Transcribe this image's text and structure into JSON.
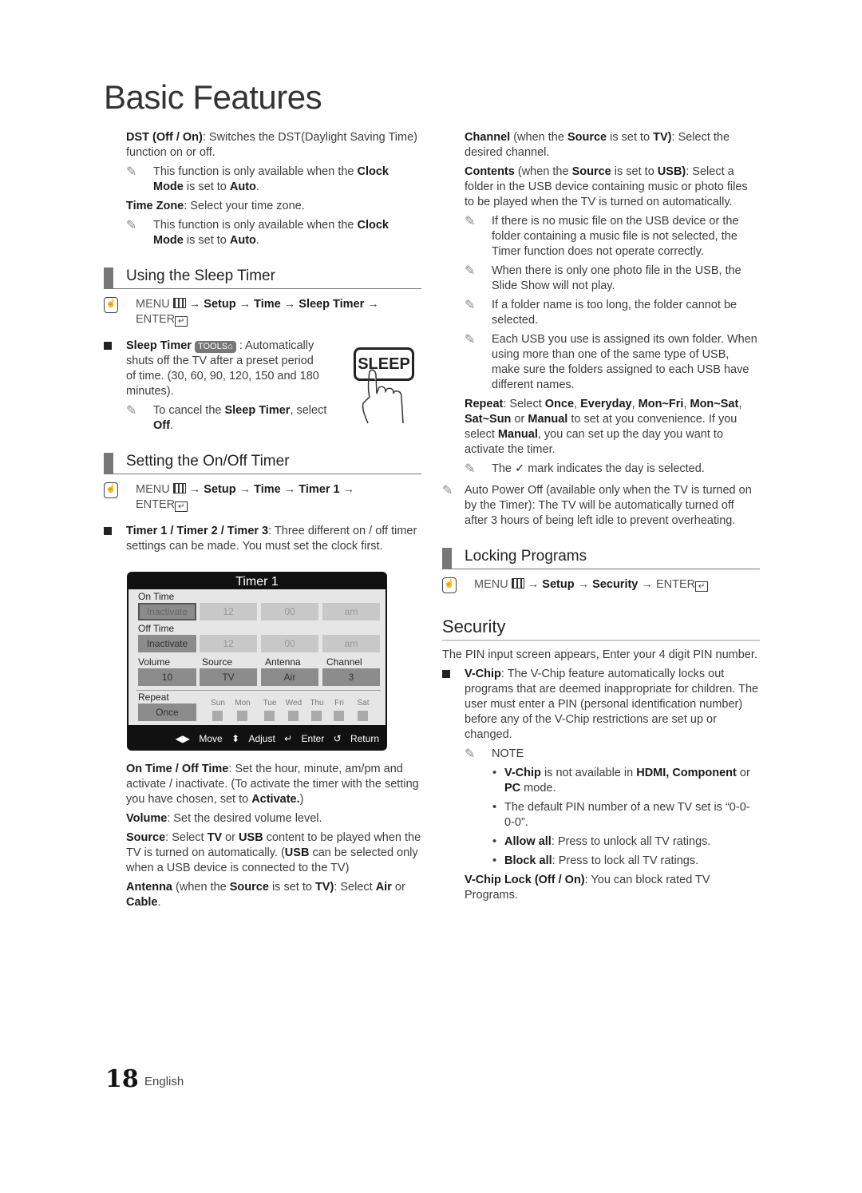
{
  "page": {
    "title": "Basic Features",
    "page_number": "18",
    "language": "English"
  },
  "left": {
    "dst": {
      "term": "DST (Off / On)",
      "text": ": Switches the DST(Daylight Saving Time) function on or off."
    },
    "dst_note": {
      "pre": "This function is only available when the ",
      "b1": "Clock Mode",
      "mid": " is set to ",
      "b2": "Auto",
      "post": "."
    },
    "timezone": {
      "term": "Time Zone",
      "text": ": Select your time zone."
    },
    "timezone_note": {
      "pre": "This function is only available when the ",
      "b1": "Clock Mode",
      "mid": " is set to ",
      "b2": "Auto",
      "post": "."
    },
    "sleep_section": {
      "heading": "Using the Sleep Timer",
      "menu_path": {
        "menu": "MENU",
        "arrow1": " → ",
        "p1": "Setup",
        "arrow2": " → ",
        "p2": "Time",
        "arrow3": " → ",
        "p3": "Sleep Timer",
        "arrow4": " →",
        "enter": "ENTER"
      },
      "bullet": {
        "term": "Sleep Timer",
        "tools": "TOOLS",
        "text": " : Automatically shuts off the TV after a preset period of time. (30, 60, 90, 120, 150 and 180 minutes)."
      },
      "note": {
        "pre": "To cancel the ",
        "b1": "Sleep Timer",
        "mid": ", select ",
        "b2": "Off",
        "post": "."
      },
      "sleep_button_label": "SLEEP"
    },
    "onoff_section": {
      "heading": "Setting the On/Off Timer",
      "menu_path": {
        "menu": "MENU",
        "arrow1": " → ",
        "p1": "Setup",
        "arrow2": " → ",
        "p2": "Time",
        "arrow3": " → ",
        "p3": "Timer 1",
        "arrow4": " →",
        "enter": "ENTER"
      },
      "bullet": {
        "term": "Timer 1 / Timer 2 / Timer 3",
        "text": ": Three different on / off timer settings can be made. You must set the clock first."
      }
    },
    "timer_screen": {
      "title": "Timer 1",
      "on_time_label": "On Time",
      "on_time": [
        "Inactivate",
        "12",
        "00",
        "am"
      ],
      "off_time_label": "Off Time",
      "off_time": [
        "Inactivate",
        "12",
        "00",
        "am"
      ],
      "volume_label": "Volume",
      "volume": "10",
      "source_label": "Source",
      "source": "TV",
      "antenna_label": "Antenna",
      "antenna": "Air",
      "channel_label": "Channel",
      "channel": "3",
      "repeat_label": "Repeat",
      "repeat": "Once",
      "days": [
        "Sun",
        "Mon",
        "Tue",
        "Wed",
        "Thu",
        "Fri",
        "Sat"
      ],
      "footer": {
        "move": "Move",
        "adjust": "Adjust",
        "enter": "Enter",
        "return": "Return"
      }
    },
    "descriptions": {
      "ontime": {
        "term": "On Time / Off Time",
        "text": ": Set the hour, minute, am/pm and activate / inactivate. (To activate the timer with the setting you have chosen, set to ",
        "b": "Activate.",
        "post": ")"
      },
      "volume": {
        "term": "Volume",
        "text": ": Set the desired volume level."
      },
      "source": {
        "term": "Source",
        "t1": ": Select ",
        "b1": "TV",
        "t2": " or ",
        "b2": "USB",
        "t3": " content to be played when the TV is turned on automatically. (",
        "b3": "USB",
        "t4": " can be selected only when a USB device is connected to the TV)"
      },
      "antenna": {
        "term": "Antenna",
        "t1": " (when the ",
        "b1": "Source",
        "t2": " is set to ",
        "b2": "TV)",
        "t3": ": Select ",
        "b3": "Air",
        "t4": " or ",
        "b4": "Cable",
        "t5": "."
      }
    }
  },
  "right": {
    "channel": {
      "term": "Channel",
      "t1": " (when the ",
      "b1": "Source",
      "t2": " is set to ",
      "b2": "TV)",
      "t3": ": Select the desired channel."
    },
    "contents": {
      "term": "Contents",
      "t1": " (when the ",
      "b1": "Source",
      "t2": " is set to ",
      "b2": "USB)",
      "t3": ": Select a folder in the USB device containing music or photo files to be played when the TV is turned on automatically."
    },
    "notes": [
      "If there is no music file on the USB device or the folder containing a music file is not selected, the Timer function does not operate correctly.",
      "When there is only one photo file in the USB, the Slide Show will not play.",
      "If a folder name is too long, the folder cannot be selected.",
      "Each USB you use is assigned its own folder. When using more than one of the same type of USB, make sure the folders assigned to each USB have different names."
    ],
    "repeat": {
      "term": "Repeat",
      "t1": ": Select ",
      "b1": "Once",
      "t2": ", ",
      "b2": "Everyday",
      "t3": ", ",
      "b3": "Mon~Fri",
      "t4": ", ",
      "b4": "Mon~Sat",
      "t5": ", ",
      "b5": "Sat~Sun",
      "t6": " or ",
      "b6": "Manual",
      "t7": " to set at you convenience. If you select ",
      "b7": "Manual",
      "t8": ", you can set up the day you want to activate the timer."
    },
    "check_note": {
      "pre": "The ",
      "check": "✓",
      "post": " mark indicates the day is selected."
    },
    "auto_power_off": "Auto Power Off (available only when the TV is turned on by the Timer): The TV will be automatically turned off after 3 hours of being left idle to prevent overheating.",
    "locking_section": {
      "heading": "Locking Programs",
      "menu_path": {
        "menu": "MENU",
        "arrow1": " → ",
        "p1": "Setup",
        "arrow2": " → ",
        "p2": "Security",
        "arrow3": " → ",
        "enter": "ENTER"
      }
    },
    "security": {
      "heading": "Security",
      "intro": "The PIN input screen appears, Enter your 4 digit PIN number.",
      "vchip": {
        "term": "V-Chip",
        "text": ": The V-Chip feature automatically locks out programs that are deemed inappropriate for children. The user must enter a PIN (personal identification number) before any of the V-Chip restrictions are set up or changed."
      },
      "note_label": "NOTE",
      "note_items": [
        {
          "b": "V-Chip",
          "t1": " is not available in ",
          "b2": "HDMI, Component",
          "t2": " or ",
          "b3": "PC",
          "t3": " mode."
        },
        {
          "t1": "The default PIN number of a new TV set is “0-0-0-0”."
        },
        {
          "b": "Allow all",
          "t1": ": Press to unlock all TV ratings."
        },
        {
          "b": "Block all",
          "t1": ": Press to lock all TV ratings."
        }
      ],
      "vchip_lock": {
        "term": "V-Chip Lock (Off / On)",
        "text": ": You can block rated TV Programs."
      }
    }
  }
}
